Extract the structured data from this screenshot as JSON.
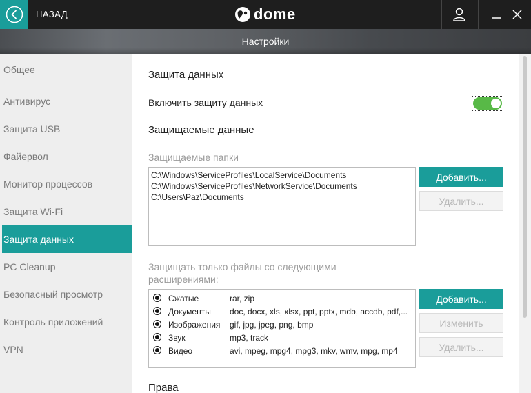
{
  "topbar": {
    "back_label": "НАЗАД",
    "logo_text": "dome",
    "accent_color": "#1a9d9a"
  },
  "page_title": "Настройки",
  "sidebar": {
    "items": [
      {
        "label": "Общее",
        "active": false
      },
      {
        "label": "Антивирус",
        "active": false
      },
      {
        "label": "Защита USB",
        "active": false
      },
      {
        "label": "Файервол",
        "active": false
      },
      {
        "label": "Монитор процессов",
        "active": false
      },
      {
        "label": "Защита Wi-Fi",
        "active": false
      },
      {
        "label": "Защита данных",
        "active": true
      },
      {
        "label": "PC Cleanup",
        "active": false
      },
      {
        "label": "Безопасный просмотр",
        "active": false
      },
      {
        "label": "Контроль приложений",
        "active": false
      },
      {
        "label": "VPN",
        "active": false
      }
    ]
  },
  "main": {
    "section_title": "Защита данных",
    "toggle_label": "Включить защиту данных",
    "toggle_on": true,
    "protected_data_title": "Защищаемые данные",
    "folders_label": "Защищаемые папки",
    "folders": [
      "C:\\Windows\\ServiceProfiles\\LocalService\\Documents",
      "C:\\Windows\\ServiceProfiles\\NetworkService\\Documents",
      "C:\\Users\\Paz\\Documents"
    ],
    "folders_add": "Добавить...",
    "folders_remove": "Удалить...",
    "ext_label_line1": "Защищать только файлы со следующими",
    "ext_label_line2": "расширениями:",
    "extensions": [
      {
        "name": "Сжатые",
        "list": "rar, zip"
      },
      {
        "name": "Документы",
        "list": "doc, docx, xls, xlsx, ppt, pptx, mdb, accdb, pdf,..."
      },
      {
        "name": "Изображения",
        "list": "gif, jpg, jpeg, png, bmp"
      },
      {
        "name": "Звук",
        "list": "mp3, track"
      },
      {
        "name": "Видео",
        "list": "avi, mpeg, mpg4, mpg3, mkv, wmv, mpg, mp4"
      }
    ],
    "ext_add": "Добавить...",
    "ext_edit": "Изменить",
    "ext_remove": "Удалить...",
    "rights_title": "Права"
  }
}
